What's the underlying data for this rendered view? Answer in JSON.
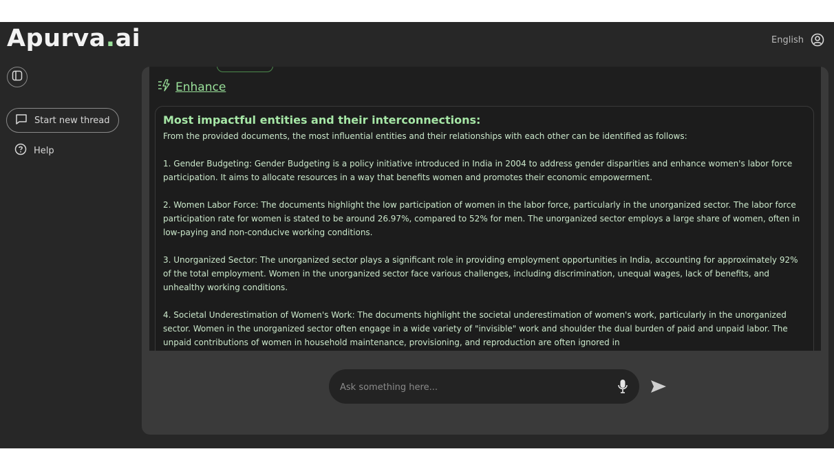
{
  "app": {
    "logo_main": "Apurva",
    "logo_dot": ".",
    "logo_suffix": "ai",
    "language": "English"
  },
  "sidebar": {
    "new_thread_label": "Start new thread",
    "help_label": "Help"
  },
  "chat": {
    "enhance_label": "Enhance",
    "response_title": "Most impactful entities and their interconnections:",
    "paragraphs": [
      "From the provided documents, the most influential entities and their relationships with each other can be identified as follows:",
      "1. Gender Budgeting: Gender Budgeting is a policy initiative introduced in India in 2004 to address gender disparities and enhance women's labor force participation. It aims to allocate resources in a way that benefits women and promotes their economic empowerment.",
      "2. Women Labor Force: The documents highlight the low participation of women in the labor force, particularly in the unorganized sector. The labor force participation rate for women is stated to be around 26.97%, compared to 52% for men. The unorganized sector employs a large share of women, often in low-paying and non-conducive working conditions.",
      "3. Unorganized Sector: The unorganized sector plays a significant role in providing employment opportunities in India, accounting for approximately 92% of the total employment. Women in the unorganized sector face various challenges, including discrimination, unequal wages, lack of benefits, and unhealthy working conditions.",
      "4. Societal Underestimation of Women's Work: The documents highlight the societal underestimation of women's work, particularly in the unorganized sector. Women in the unorganized sector often engage in a wide variety of \"invisible\" work and shoulder the dual burden of paid and unpaid labor. The unpaid contributions of women in household maintenance, provisioning, and reproduction are often ignored in"
    ]
  },
  "input": {
    "placeholder": "Ask something here..."
  },
  "colors": {
    "accent": "#9be29b",
    "background": "#272727",
    "panel": "#3a3a3a",
    "chat_bg": "#1e1e1e"
  },
  "icons": [
    "user-circle-icon",
    "sidebar-toggle-icon",
    "chat-bubble-icon",
    "help-circle-icon",
    "enhance-sparkle-icon",
    "microphone-icon",
    "send-icon"
  ]
}
